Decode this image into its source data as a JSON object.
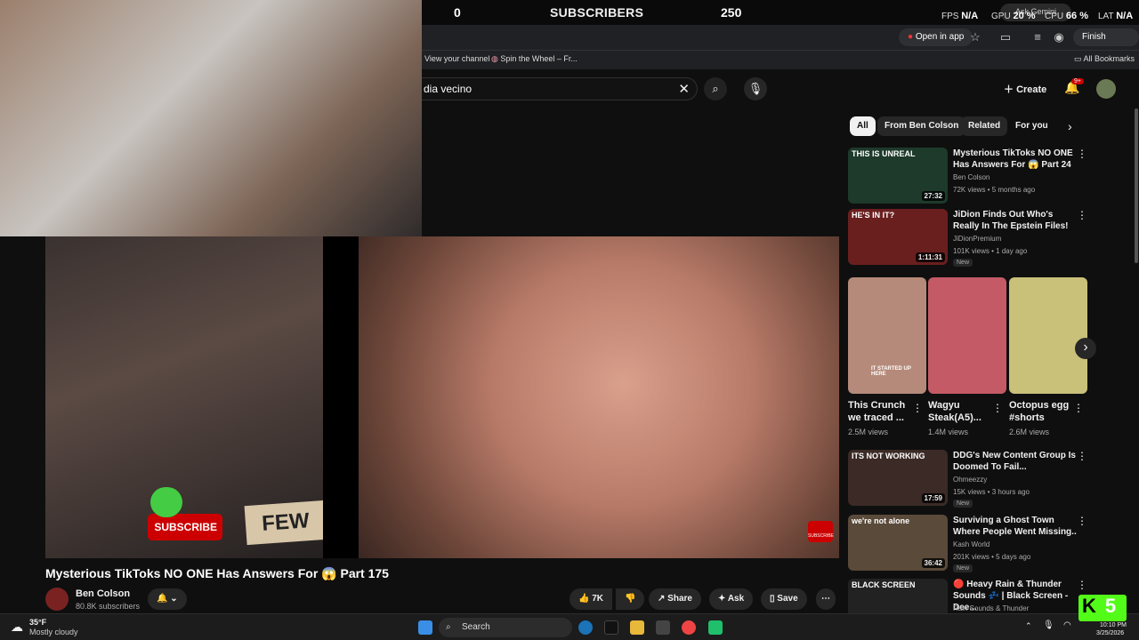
{
  "overlay": {
    "left_count": "0",
    "label": "SUBSCRIBERS",
    "right_count": "250",
    "ask": "Ask Gemini",
    "fps_label": "FPS",
    "fps": "N/A",
    "gpu_label": "GPU",
    "gpu": "20 %",
    "cpu_label": "CPU",
    "cpu": "66 %",
    "lat_label": "LAT",
    "lat": "N/A"
  },
  "browser": {
    "open_in_app": "Open in app",
    "finish_update": "Finish update",
    "bookmarks": [
      "View your channel",
      "Spin the Wheel – Fr..."
    ],
    "all_bookmarks": "All Bookmarks"
  },
  "yt": {
    "search_query": "dia vecino",
    "create": "Create",
    "notif_count": "9+"
  },
  "video": {
    "title": "Mysterious TikToks NO ONE Has Answers For 😱 Part 175",
    "channel": "Ben Colson",
    "subs": "80.8K subscribers",
    "overlay_subscribe": "SUBSCRIBE",
    "wall_text": "FEW",
    "watermark": "SUBSCRIBE",
    "actions": {
      "likes": "7K",
      "share": "Share",
      "ask": "Ask",
      "save": "Save"
    }
  },
  "chips": [
    "All",
    "From Ben Colson",
    "Related",
    "For you"
  ],
  "recs": [
    {
      "title": "Mysterious TikToks NO ONE Has Answers For 😱 Part 24",
      "channel": "Ben Colson",
      "meta": "72K views • 5 months ago",
      "duration": "27:32",
      "badge": "",
      "thumb_text": "THIS IS UNREAL",
      "color": "#1d3a2a"
    },
    {
      "title": "JiDion Finds Out Who's Really In The Epstein Files!",
      "channel": "JiDionPremium",
      "meta": "101K views • 1 day ago",
      "duration": "1:11:31",
      "badge": "New",
      "thumb_text": "HE'S IN IT?",
      "color": "#6a1f1f"
    },
    {
      "title": "DDG's New Content Group Is Doomed To Fail...",
      "channel": "Ohmeezzy",
      "meta": "15K views • 3 hours ago",
      "duration": "17:59",
      "badge": "New",
      "thumb_text": "ITS NOT WORKING",
      "color": "#3b2a25"
    },
    {
      "title": "Surviving a Ghost Town Where People Went Missing..",
      "channel": "Kash World",
      "meta": "201K views • 5 days ago",
      "duration": "36:42",
      "badge": "New",
      "thumb_text": "we're not alone",
      "color": "#5a4a3a"
    },
    {
      "title": "🔴 Heavy Rain & Thunder Sounds 💤 | Black Screen - Dee...",
      "channel": "Rain Sounds & Thunder",
      "meta": "",
      "duration": "",
      "badge": "",
      "thumb_text": "BLACK SCREEN",
      "color": "#222"
    }
  ],
  "shorts": [
    {
      "title": "This Crunch we traced ...",
      "views": "2.5M views",
      "text": "IT STARTED UP HERE",
      "color": "#b58a7a"
    },
    {
      "title": "Wagyu Steak(A5)...",
      "views": "1.4M views",
      "text": "",
      "color": "#c45a66"
    },
    {
      "title": "Octopus egg #shorts",
      "views": "2.6M views",
      "text": "",
      "color": "#c9c07a"
    }
  ],
  "taskbar": {
    "temp": "35°F",
    "weather": "Mostly cloudy",
    "search": "Search",
    "time": "10:10 PM",
    "date": "3/25/2026",
    "overlay_num": "5"
  }
}
